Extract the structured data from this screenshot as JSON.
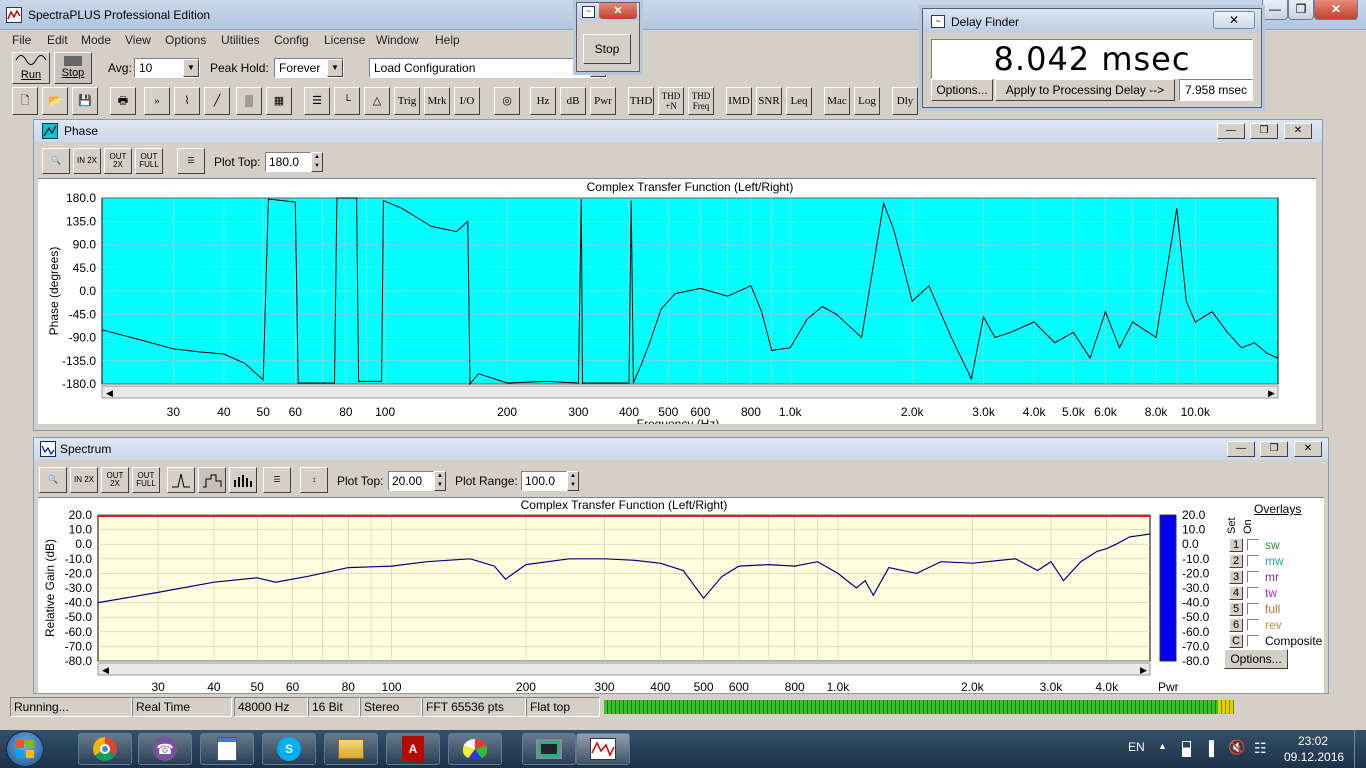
{
  "app": {
    "title": "SpectraPLUS Professional Edition"
  },
  "menu": [
    "File",
    "Edit",
    "Mode",
    "View",
    "Options",
    "Utilities",
    "Config",
    "License",
    "Window",
    "Help"
  ],
  "toolbar": {
    "run_label": "Run",
    "stop_label": "Stop",
    "avg_label": "Avg:",
    "avg_value": "10",
    "peak_hold_label": "Peak Hold:",
    "peak_hold_value": "Forever",
    "config_value": "Load Configuration",
    "tools": [
      "",
      "",
      "",
      "",
      "",
      "",
      "",
      "",
      "",
      "",
      "",
      "",
      "",
      "",
      "Trig",
      "Mrk",
      "I/O",
      "",
      "Hz",
      "dB",
      "Pwr",
      "THD",
      "THD +N",
      "THD Freq",
      "IMD",
      "SNR",
      "Leq",
      "Mac",
      "Log",
      "Dly"
    ]
  },
  "stop_popup": {
    "button": "Stop"
  },
  "delay_finder": {
    "title": "Delay Finder",
    "value": "8.042 msec",
    "options_button": "Options...",
    "apply_button": "Apply to Processing Delay -->",
    "applied_value": "7.958 msec"
  },
  "phase_window": {
    "title": "Phase",
    "plot_top_label": "Plot Top:",
    "plot_top_value": "180.0",
    "buttons": {
      "zoom_in_2x": "IN 2X",
      "zoom_out_2x": "OUT 2X",
      "zoom_out_full": "OUT FULL"
    },
    "chart_title": "Complex Transfer Function (Left/Right)",
    "ylabel": "Phase (degrees)",
    "xlabel": "Frequency (Hz)"
  },
  "spectrum_window": {
    "title": "Spectrum",
    "plot_top_label": "Plot Top:",
    "plot_top_value": "20.00",
    "plot_range_label": "Plot Range:",
    "plot_range_value": "100.0",
    "chart_title": "Complex Transfer Function (Left/Right)",
    "ylabel": "Relative Gain (dB)",
    "pwr_label": "Pwr",
    "overlays": {
      "title": "Overlays",
      "set_header": "Set",
      "on_header": "On",
      "items": [
        {
          "num": "1",
          "name": "sw",
          "color": "#2f9a2f"
        },
        {
          "num": "2",
          "name": "mw",
          "color": "#2aa5a5"
        },
        {
          "num": "3",
          "name": "mr",
          "color": "#8a2a8a"
        },
        {
          "num": "4",
          "name": "tw",
          "color": "#cc22cc"
        },
        {
          "num": "5",
          "name": "full",
          "color": "#b0762c"
        },
        {
          "num": "6",
          "name": "rev",
          "color": "#d08a40"
        },
        {
          "num": "C",
          "name": "Composite",
          "color": "#000000"
        }
      ],
      "options_button": "Options..."
    }
  },
  "status": {
    "state": "Running...",
    "mode": "Real Time",
    "rate": "48000 Hz",
    "bits": "16 Bit",
    "channels": "Stereo",
    "fft": "FFT 65536 pts",
    "window": "Flat top"
  },
  "taskbar": {
    "lang": "EN",
    "time": "23:02",
    "date": "09.12.2016"
  },
  "chart_data": [
    {
      "type": "line",
      "title": "Complex Transfer Function (Left/Right)",
      "xlabel": "Frequency (Hz)",
      "ylabel": "Phase (degrees)",
      "x_scale": "log",
      "xlim": [
        20,
        16000
      ],
      "ylim": [
        -180,
        180
      ],
      "xticks": [
        30,
        40,
        50,
        60,
        80,
        100,
        200,
        300,
        400,
        500,
        600,
        800,
        1000,
        2000,
        3000,
        4000,
        5000,
        6000,
        8000,
        10000
      ],
      "xtick_labels": [
        "30",
        "40",
        "50",
        "60",
        "80",
        "100",
        "200",
        "300",
        "400",
        "500",
        "600",
        "800",
        "1.0k",
        "2.0k",
        "3.0k",
        "4.0k",
        "5.0k",
        "6.0k",
        "8.0k",
        "10.0k"
      ],
      "yticks": [
        180,
        135,
        90,
        45,
        0,
        -45,
        -90,
        -135,
        -180
      ],
      "ytick_labels": [
        "180.0",
        "135.0",
        "90.0",
        "45.0",
        "0.0",
        "-45.0",
        "-90.0",
        "-135.0",
        "-180.0"
      ],
      "background": "#00ffff",
      "grid": true,
      "series": [
        {
          "color": "#000000",
          "points": [
            [
              20,
              -75
            ],
            [
              25,
              -95
            ],
            [
              30,
              -112
            ],
            [
              35,
              -118
            ],
            [
              40,
              -122
            ],
            [
              45,
              -140
            ],
            [
              50,
              -172
            ],
            [
              51.5,
              178
            ],
            [
              60,
              172
            ],
            [
              61,
              -178
            ],
            [
              75,
              -178
            ],
            [
              76,
              180
            ],
            [
              85,
              180
            ],
            [
              86,
              -175
            ],
            [
              98,
              -175
            ],
            [
              99,
              175
            ],
            [
              110,
              160
            ],
            [
              130,
              125
            ],
            [
              150,
              115
            ],
            [
              160,
              135
            ],
            [
              162,
              -180
            ],
            [
              170,
              -160
            ],
            [
              200,
              -178
            ],
            [
              250,
              -175
            ],
            [
              300,
              -178
            ],
            [
              305,
              178
            ],
            [
              307,
              -178
            ],
            [
              400,
              -178
            ],
            [
              405,
              175
            ],
            [
              410,
              -178
            ],
            [
              430,
              -140
            ],
            [
              450,
              -100
            ],
            [
              480,
              -35
            ],
            [
              520,
              -5
            ],
            [
              600,
              5
            ],
            [
              700,
              -10
            ],
            [
              800,
              10
            ],
            [
              850,
              -40
            ],
            [
              900,
              -115
            ],
            [
              1000,
              -110
            ],
            [
              1100,
              -55
            ],
            [
              1200,
              -30
            ],
            [
              1300,
              -45
            ],
            [
              1500,
              -90
            ],
            [
              1700,
              170
            ],
            [
              1800,
              120
            ],
            [
              2000,
              -20
            ],
            [
              2200,
              10
            ],
            [
              2500,
              -90
            ],
            [
              2800,
              -170
            ],
            [
              3000,
              -50
            ],
            [
              3200,
              -90
            ],
            [
              3500,
              -80
            ],
            [
              4000,
              -60
            ],
            [
              4500,
              -100
            ],
            [
              5000,
              -80
            ],
            [
              5500,
              -130
            ],
            [
              6000,
              -40
            ],
            [
              6500,
              -110
            ],
            [
              7000,
              -60
            ],
            [
              8000,
              -90
            ],
            [
              9000,
              160
            ],
            [
              9500,
              -20
            ],
            [
              10000,
              -60
            ],
            [
              11000,
              -40
            ],
            [
              12000,
              -80
            ],
            [
              13000,
              -110
            ],
            [
              14000,
              -100
            ],
            [
              15000,
              -120
            ],
            [
              16000,
              -130
            ]
          ]
        }
      ]
    },
    {
      "type": "line",
      "title": "Complex Transfer Function (Left/Right)",
      "ylabel": "Relative Gain (dB)",
      "x_scale": "log",
      "xlim": [
        22,
        5000
      ],
      "ylim": [
        -80,
        20
      ],
      "xticks": [
        30,
        40,
        50,
        60,
        80,
        100,
        200,
        300,
        400,
        500,
        600,
        800,
        1000,
        2000,
        3000,
        4000
      ],
      "xtick_labels": [
        "30",
        "40",
        "50",
        "60",
        "80",
        "100",
        "200",
        "300",
        "400",
        "500",
        "600",
        "800",
        "1.0k",
        "2.0k",
        "3.0k",
        "4.0k"
      ],
      "yticks": [
        20,
        10,
        0,
        -10,
        -20,
        -30,
        -40,
        -50,
        -60,
        -70,
        -80
      ],
      "ytick_labels": [
        "20.0",
        "10.0",
        "0.0",
        "-10.0",
        "-20.0",
        "-30.0",
        "-40.0",
        "-50.0",
        "-60.0",
        "-70.0",
        "-80.0"
      ],
      "background": "#ffffe0",
      "grid": true,
      "series": [
        {
          "color": "#000080",
          "points": [
            [
              22,
              -40
            ],
            [
              30,
              -33
            ],
            [
              40,
              -26
            ],
            [
              50,
              -23
            ],
            [
              55,
              -26
            ],
            [
              65,
              -22
            ],
            [
              80,
              -16
            ],
            [
              100,
              -15
            ],
            [
              120,
              -12
            ],
            [
              150,
              -10
            ],
            [
              170,
              -15
            ],
            [
              180,
              -24
            ],
            [
              200,
              -14
            ],
            [
              250,
              -10
            ],
            [
              300,
              -10
            ],
            [
              350,
              -11
            ],
            [
              400,
              -13
            ],
            [
              450,
              -18
            ],
            [
              500,
              -37
            ],
            [
              550,
              -22
            ],
            [
              600,
              -15
            ],
            [
              700,
              -14
            ],
            [
              800,
              -15
            ],
            [
              900,
              -12
            ],
            [
              1000,
              -20
            ],
            [
              1100,
              -30
            ],
            [
              1150,
              -25
            ],
            [
              1200,
              -35
            ],
            [
              1300,
              -16
            ],
            [
              1500,
              -20
            ],
            [
              1700,
              -12
            ],
            [
              2000,
              -13
            ],
            [
              2500,
              -10
            ],
            [
              2800,
              -18
            ],
            [
              3000,
              -12
            ],
            [
              3200,
              -25
            ],
            [
              3500,
              -12
            ],
            [
              3800,
              -5
            ],
            [
              4000,
              -3
            ],
            [
              4200,
              0
            ],
            [
              4500,
              5
            ],
            [
              5000,
              7
            ]
          ]
        }
      ]
    }
  ]
}
